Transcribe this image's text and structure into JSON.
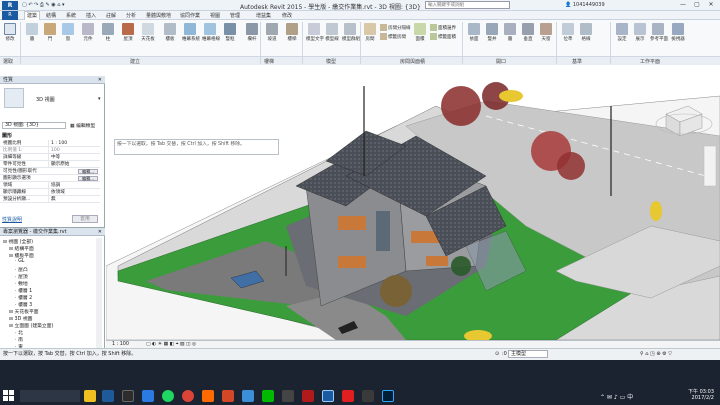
{
  "window": {
    "title": "Autodesk Revit 2015 - 學生版 - 繳交作業集.rvt - 3D 視圖: {3D}",
    "search_placeholder": "輸入關鍵字或詞組",
    "user": "1041449039",
    "app_logo": "R"
  },
  "menu": {
    "file": "R",
    "tabs": [
      "建築",
      "結構",
      "系統",
      "插入",
      "註解",
      "分析",
      "量體與敷地",
      "協同作業",
      "視圖",
      "管理",
      "增益集",
      "修改"
    ]
  },
  "ribbon": {
    "buttons": [
      {
        "label": "修改",
        "icon": "arrow-icon"
      },
      {
        "label": "牆",
        "icon": "wall-icon"
      },
      {
        "label": "門",
        "icon": "door-icon"
      },
      {
        "label": "窗",
        "icon": "window-icon"
      },
      {
        "label": "元件",
        "icon": "component-icon"
      },
      {
        "label": "柱",
        "icon": "column-icon"
      },
      {
        "label": "屋頂",
        "icon": "roof-icon"
      },
      {
        "label": "天花板",
        "icon": "ceiling-icon"
      },
      {
        "label": "樓板",
        "icon": "floor-icon"
      },
      {
        "label": "帷幕系統",
        "icon": "curtain-system-icon"
      },
      {
        "label": "帷幕格線",
        "icon": "curtain-grid-icon"
      },
      {
        "label": "豎框",
        "icon": "mullion-icon"
      },
      {
        "label": "欄杆",
        "icon": "railing-icon"
      },
      {
        "label": "坡道",
        "icon": "ramp-icon"
      },
      {
        "label": "樓梯",
        "icon": "stair-icon"
      },
      {
        "label": "模型文字",
        "icon": "model-text-icon"
      },
      {
        "label": "模型線",
        "icon": "model-line-icon"
      },
      {
        "label": "模型群組",
        "icon": "model-group-icon"
      },
      {
        "label": "房間",
        "icon": "room-icon"
      },
      {
        "label": "面積",
        "icon": "area-icon"
      },
      {
        "label": "依面",
        "icon": "by-face-icon"
      },
      {
        "label": "豎井",
        "icon": "shaft-icon"
      },
      {
        "label": "牆",
        "icon": "opening-wall-icon"
      },
      {
        "label": "垂直",
        "icon": "vertical-icon"
      },
      {
        "label": "天窗",
        "icon": "dormer-icon"
      },
      {
        "label": "位準",
        "icon": "level-icon"
      },
      {
        "label": "格線",
        "icon": "grid-icon"
      },
      {
        "label": "設定",
        "icon": "set-icon"
      },
      {
        "label": "展示",
        "icon": "show-icon"
      },
      {
        "label": "參考平面",
        "icon": "ref-plane-icon"
      },
      {
        "label": "檢視器",
        "icon": "viewer-icon"
      }
    ],
    "small": [
      "房間分隔線",
      "標籤房間",
      "面積邊界",
      "標籤面積"
    ],
    "panels": [
      "選取",
      "建立",
      "樓梯",
      "模型",
      "房間與面積",
      "開口",
      "基準",
      "工作平面"
    ]
  },
  "properties": {
    "header": "性質",
    "type_name": "3D 視圖",
    "selector": "3D 視圖: {3D}",
    "edit_type": "編輯類型",
    "section": "圖形",
    "rows": [
      {
        "k": "視圖比例",
        "v": "1 : 100"
      },
      {
        "k": "比例值 1:",
        "v": "100"
      },
      {
        "k": "詳細等級",
        "v": "中等"
      },
      {
        "k": "零件可見性",
        "v": "顯示原始"
      },
      {
        "k": "可見性/圖形取代",
        "v": "",
        "btn": "編輯..."
      },
      {
        "k": "圖形顯示選項",
        "v": "",
        "btn": "編輯..."
      },
      {
        "k": "領域",
        "v": "協調"
      },
      {
        "k": "顯示隱藏線",
        "v": "依領域"
      },
      {
        "k": "預設分析顯...",
        "v": "無"
      }
    ],
    "help_link": "性質說明",
    "apply": "套用"
  },
  "browser": {
    "header": "專案瀏覽器 - 繳交作業集.rvt",
    "items": [
      {
        "t": "視圖 (全部)",
        "indent": 0
      },
      {
        "t": "結構平面",
        "indent": 1
      },
      {
        "t": "樓板平面",
        "indent": 1
      },
      {
        "t": "GL",
        "indent": 2
      },
      {
        "t": "屋凸",
        "indent": 2
      },
      {
        "t": "屋頂",
        "indent": 2
      },
      {
        "t": "敷地",
        "indent": 2
      },
      {
        "t": "樓層 1",
        "indent": 2
      },
      {
        "t": "樓層 2",
        "indent": 2
      },
      {
        "t": "樓層 3",
        "indent": 2
      },
      {
        "t": "天花板平面",
        "indent": 1
      },
      {
        "t": "3D 視圖",
        "indent": 1
      },
      {
        "t": "立面圖 (建築立面)",
        "indent": 1
      },
      {
        "t": "北",
        "indent": 2
      },
      {
        "t": "南",
        "indent": 2
      },
      {
        "t": "東",
        "indent": 2
      }
    ]
  },
  "view": {
    "tooltip": "按一下以選取，按 Tab 交替，按 Ctrl 加入，按 Shift 移除。",
    "scale": "1 : 100"
  },
  "status": {
    "text": "按一下以選取，按 Tab 交替，按 Ctrl 加入，按 Shift 移除。",
    "model": "主模型",
    "zero": ":0"
  },
  "taskbar": {
    "time": "下午 03:03",
    "date": "2017/2/2"
  }
}
